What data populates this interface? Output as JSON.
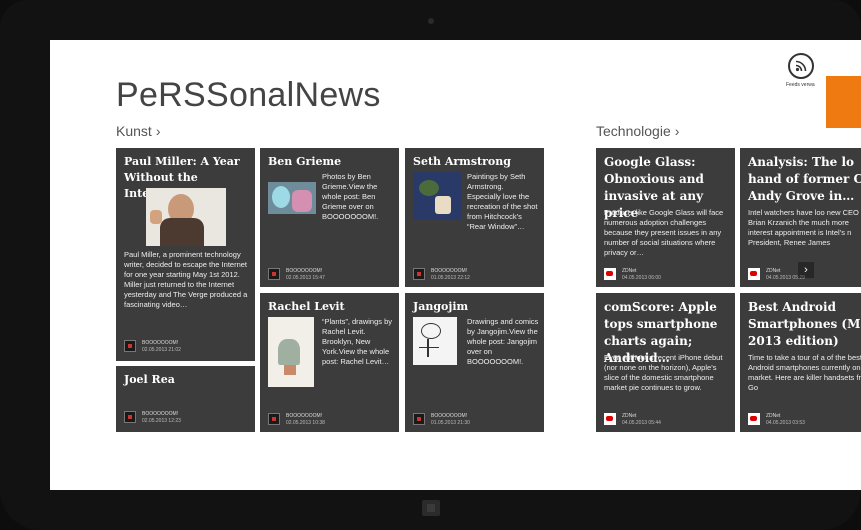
{
  "app": {
    "title": "PeRSSonalNews",
    "feeds_label": "Feeds verwa"
  },
  "colors": {
    "tile_bg": "#3c3c3c",
    "accent": "#f07a12",
    "screen_bg": "#ffffff"
  },
  "sections": [
    {
      "name": "Kunst",
      "chevron": "›",
      "tiles": [
        {
          "title": "Paul Miller: A Year Without the Internet",
          "summary": "Paul Miller, a prominent technology writer, decided to escape the Internet for one year starting May 1st 2012. Miller just returned to the Internet yesterday and The Verge produced a fascinating video…",
          "source": "BOOOOOOOM!",
          "date": "02.05.2013 21:02",
          "image": "video-thumbnail"
        },
        {
          "title": "Joel Rea",
          "summary": "",
          "source": "BOOOOOOOM!",
          "date": "02.05.2013 12:23"
        },
        {
          "title": "Ben Grieme",
          "summary": "Photos by Ben Grieme.View the whole post: Ben Grieme over on BOOOOOOOM!.",
          "source": "BOOOOOOOM!",
          "date": "02.05.2013 15:47",
          "image": "photo-thumbnail"
        },
        {
          "title": "Rachel Levit",
          "summary": "“Plants”, drawings by Rachel Levit. Brooklyn, New York.View the whole post: Rachel Levit…",
          "source": "BOOOOOOOM!",
          "date": "02.05.2013 10:38",
          "image": "drawing-thumbnail"
        },
        {
          "title": "Seth Armstrong",
          "summary": "Paintings by Seth Armstrong. Especially love the recreation of the shot from Hitchcock’s “Rear Window”…",
          "source": "BOOOOOOOM!",
          "date": "01.05.2013 22:12",
          "image": "painting-thumbnail"
        },
        {
          "title": "Jangojim",
          "summary": "Drawings and comics by Jangojim.View the whole post: Jangojim over on BOOOOOOOM!.",
          "source": "BOOOOOOOM!",
          "date": "01.05.2013 21:30",
          "image": "comic-thumbnail"
        }
      ]
    },
    {
      "name": "Technologie",
      "chevron": "›",
      "tiles": [
        {
          "title": "Google Glass: Obnoxious and invasive at any price",
          "summary": "Products like Google Glass will face numerous adoption challenges because they present issues in any number of social situations where privacy or…",
          "source": "ZDNet",
          "date": "04.05.2013 06:00"
        },
        {
          "title": "comScore: Apple tops smartphone charts again; Android…",
          "summary": "Even without a recent iPhone debut (nor none on the horizon), Apple’s slice of the domestic smartphone market pie continues to grow.",
          "source": "ZDNet",
          "date": "04.05.2013 05:44"
        },
        {
          "title": "Analysis: The lo hand of former C Andy Grove in…",
          "summary": "Intel watchers have loo new CEO Brian Krzanich the much more interest appointment is Intel’s n President, Renee James",
          "source": "ZDNet",
          "date": "04.05.2013 05:29",
          "arrow": "›"
        },
        {
          "title": "Best Android Smartphones (M 2013 edition)",
          "summary": "Time to take a tour of a of the best Android smartphones currently on the market. Here are killer handsets from Go",
          "source": "ZDNet",
          "date": "04.05.2013 03:53"
        }
      ]
    }
  ]
}
